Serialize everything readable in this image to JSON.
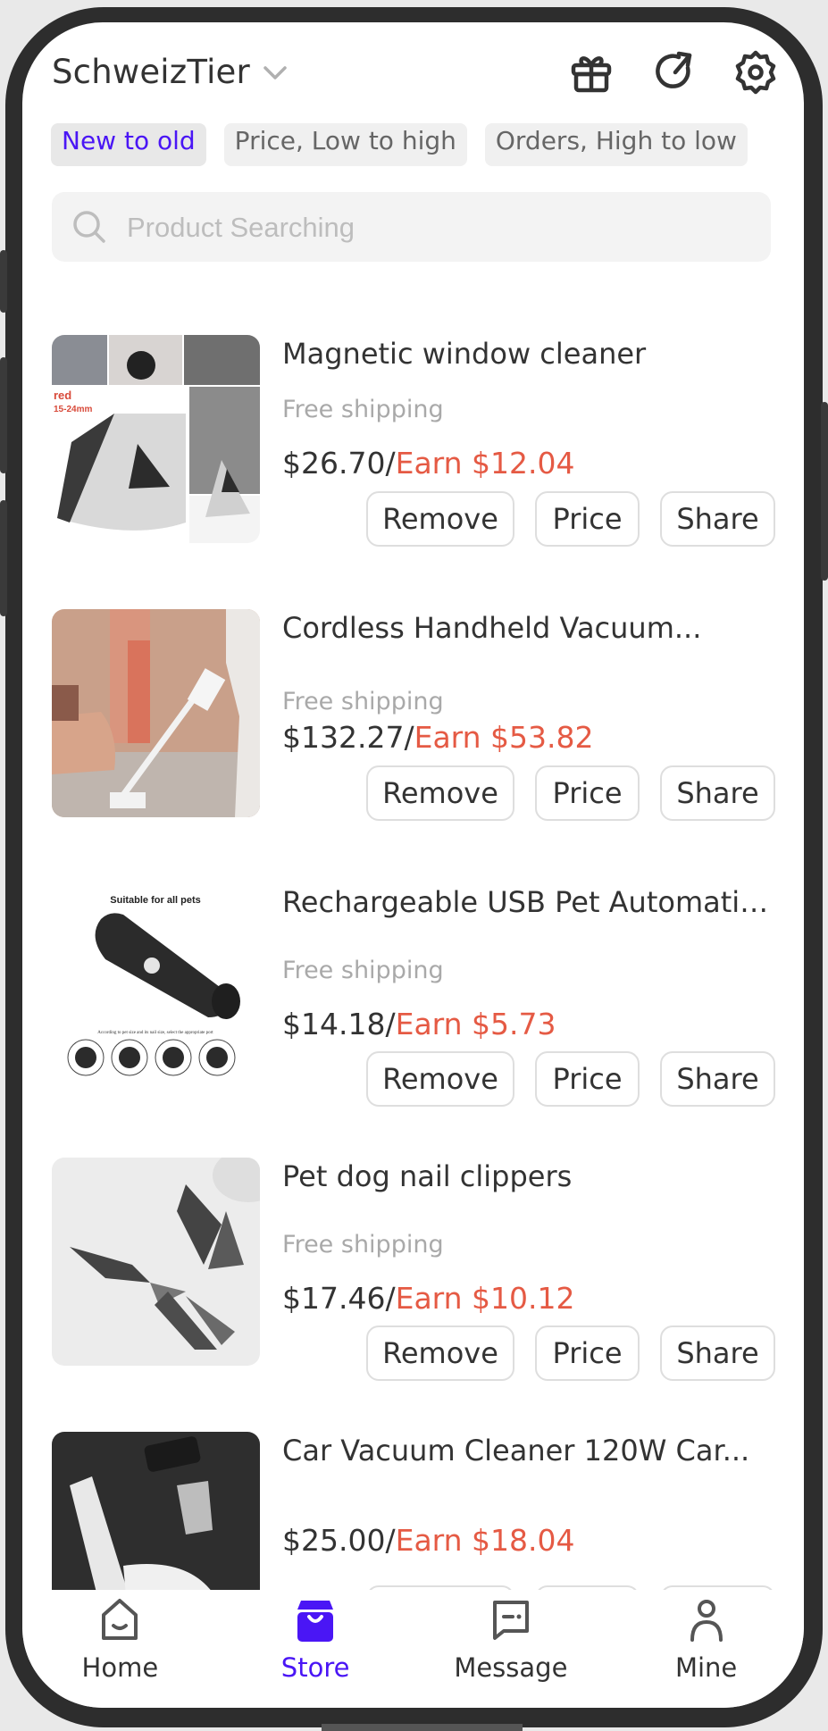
{
  "header": {
    "title": "SchweizTier",
    "icons": [
      "chevron-down-icon",
      "gift-icon",
      "refresh-icon",
      "gear-icon"
    ]
  },
  "sort_chips": [
    {
      "label": "New to old",
      "active": true
    },
    {
      "label": "Price, Low to high",
      "active": false
    },
    {
      "label": "Orders, High to low",
      "active": false
    }
  ],
  "search": {
    "placeholder": "Product Searching",
    "value": ""
  },
  "products": [
    {
      "title": "Magnetic window cleaner",
      "shipping": "Free shipping",
      "price": "$26.70/",
      "earn": "Earn $12.04",
      "image": "magnetic-window-cleaner-photo"
    },
    {
      "title": "Cordless Handheld Vacuum...",
      "shipping": "Free shipping",
      "price": "$132.27/",
      "earn": "Earn $53.82",
      "image": "cordless-vacuum-photo"
    },
    {
      "title": "Rechargeable USB Pet Automatic...",
      "shipping": "Free shipping",
      "price": "$14.18/",
      "earn": "Earn $5.73",
      "image": "pet-nail-grinder-photo",
      "image_caption": "Suitable for all pets"
    },
    {
      "title": "Pet dog nail clippers",
      "shipping": "Free shipping",
      "price": "$17.46/",
      "earn": "Earn $10.12",
      "image": "nail-clippers-photo"
    },
    {
      "title": "Car Vacuum Cleaner 120W Car...",
      "shipping": "",
      "price": "$25.00/",
      "earn": "Earn $18.04",
      "image": "car-vacuum-photo"
    }
  ],
  "actions": {
    "remove": "Remove",
    "price": "Price",
    "share": "Share"
  },
  "bottom_nav": [
    {
      "label": "Home",
      "icon": "home-icon",
      "active": false
    },
    {
      "label": "Store",
      "icon": "store-bag-icon",
      "active": true
    },
    {
      "label": "Message",
      "icon": "message-icon",
      "active": false
    },
    {
      "label": "Mine",
      "icon": "person-icon",
      "active": false
    }
  ],
  "colors": {
    "accent": "#4a16f5",
    "earn": "#e55a44",
    "muted": "#a9a9a9",
    "text": "#333333"
  }
}
